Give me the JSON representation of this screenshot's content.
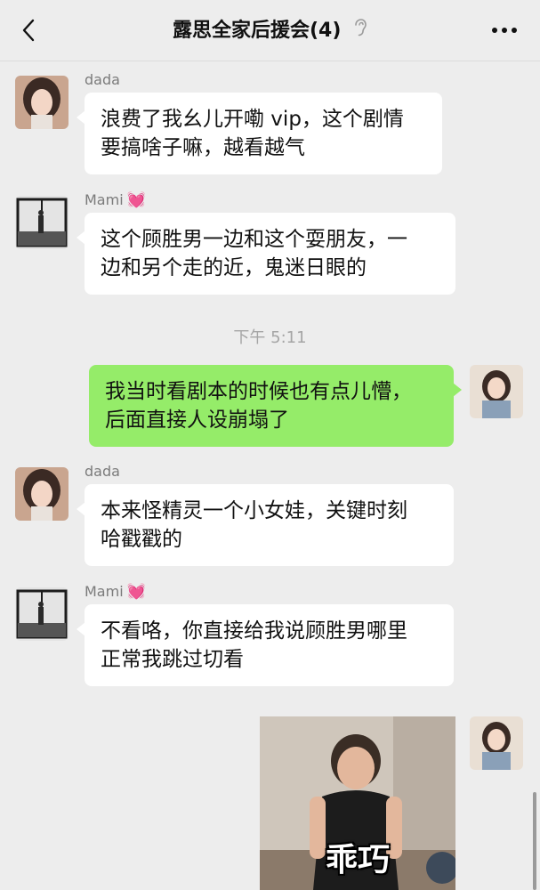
{
  "header": {
    "title": "露思全家后援会(4)",
    "back_icon": "chevron-left-icon",
    "mute_icon": "ear-icon",
    "more_icon": "more-dots-icon"
  },
  "messages": [
    {
      "sender": "dada",
      "text_lines": [
        "浪费了我幺儿开嘞 vip，这个剧情",
        "要搞啥子嘛，越看越气"
      ]
    },
    {
      "sender": "Mami",
      "sender_emoji": "💓",
      "text_lines": [
        "这个顾胜男一边和这个耍朋友，一",
        "边和另个走的近，鬼迷日眼的"
      ]
    },
    {
      "timestamp": "下午 5:11"
    },
    {
      "sender": "me",
      "text_lines": [
        "我当时看剧本的时候也有点儿懵，",
        "后面直接人设崩塌了"
      ]
    },
    {
      "sender": "dada",
      "text_lines": [
        "本来怪精灵一个小女娃，关键时刻",
        "哈戳戳的"
      ]
    },
    {
      "sender": "Mami",
      "sender_emoji": "💓",
      "text_lines": [
        "不看咯，你直接给我说顾胜男哪里",
        "正常我跳过切看"
      ]
    },
    {
      "sender": "me",
      "sticker_caption": "乖巧"
    }
  ],
  "colors": {
    "background": "#ededed",
    "my_bubble": "#95ec69",
    "other_bubble": "#ffffff"
  }
}
